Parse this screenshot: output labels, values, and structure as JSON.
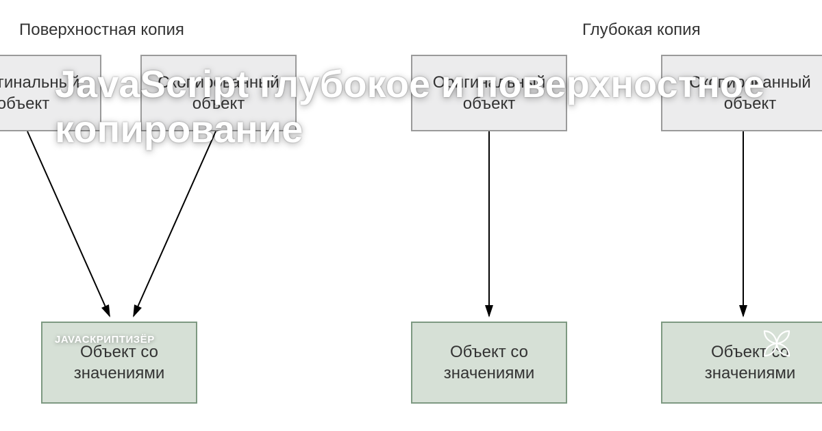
{
  "overlay": {
    "title": "JavaScript глубокое и поверхностное копирование",
    "author": "JAVAСКРИПТИЗЁР"
  },
  "diagram": {
    "shallow_label": "Поверхностная копия",
    "deep_label": "Глубокая копия",
    "boxes": {
      "shallow_original": "Оригинальный объект",
      "shallow_copy": "Скопированный объект",
      "shallow_values": "Объект со значениями",
      "deep_original": "Оригинальный объект",
      "deep_copy": "Скопированный объект",
      "deep_values_1": "Объект со значениями",
      "deep_values_2": "Объект со значениями"
    }
  }
}
